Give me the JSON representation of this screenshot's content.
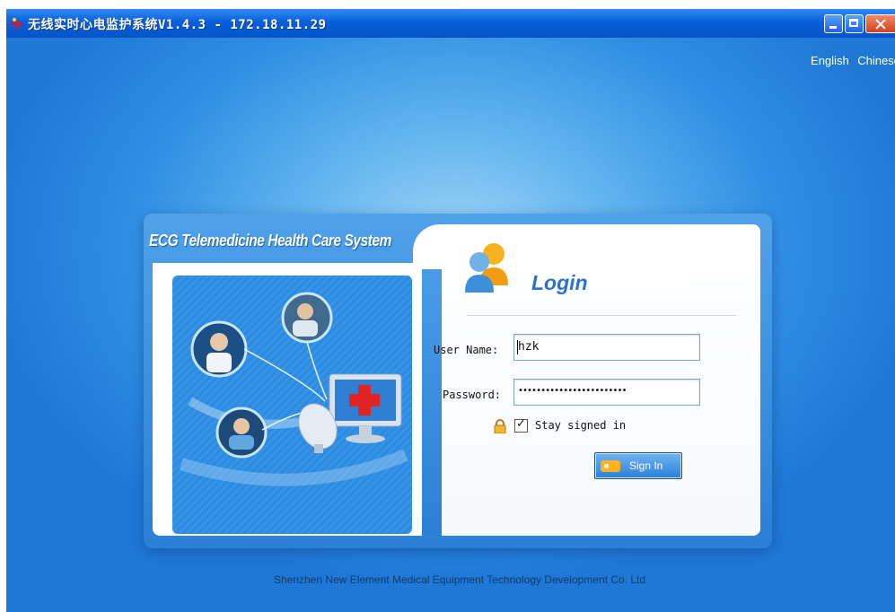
{
  "window": {
    "title": "无线实时心电监护系统V1.4.3 - 172.18.11.29",
    "title_bar_color": "#0a5fd8",
    "controls": [
      "minimize-icon",
      "maximize-icon",
      "close-icon"
    ]
  },
  "language_switch": {
    "english": "English",
    "chinese": "Chinese"
  },
  "panel": {
    "system_title": "ECG Telemedicine Health Care System",
    "login_heading": "Login",
    "user_name_label": "User Name:",
    "user_name_value": "hzk",
    "password_label": "Password:",
    "password_value": "••••••••••••••••••••••••",
    "stay_signed_in_label": "Stay signed in",
    "stay_signed_in_checked": true,
    "sign_in_label": "Sign In"
  },
  "footer": {
    "company": "Shenzhen New Element Medical Equipment Technology Development Co. Ltd"
  },
  "colors": {
    "background": "#2f8ee3",
    "accent": "#2b73c8",
    "close_button": "#d4401e"
  }
}
